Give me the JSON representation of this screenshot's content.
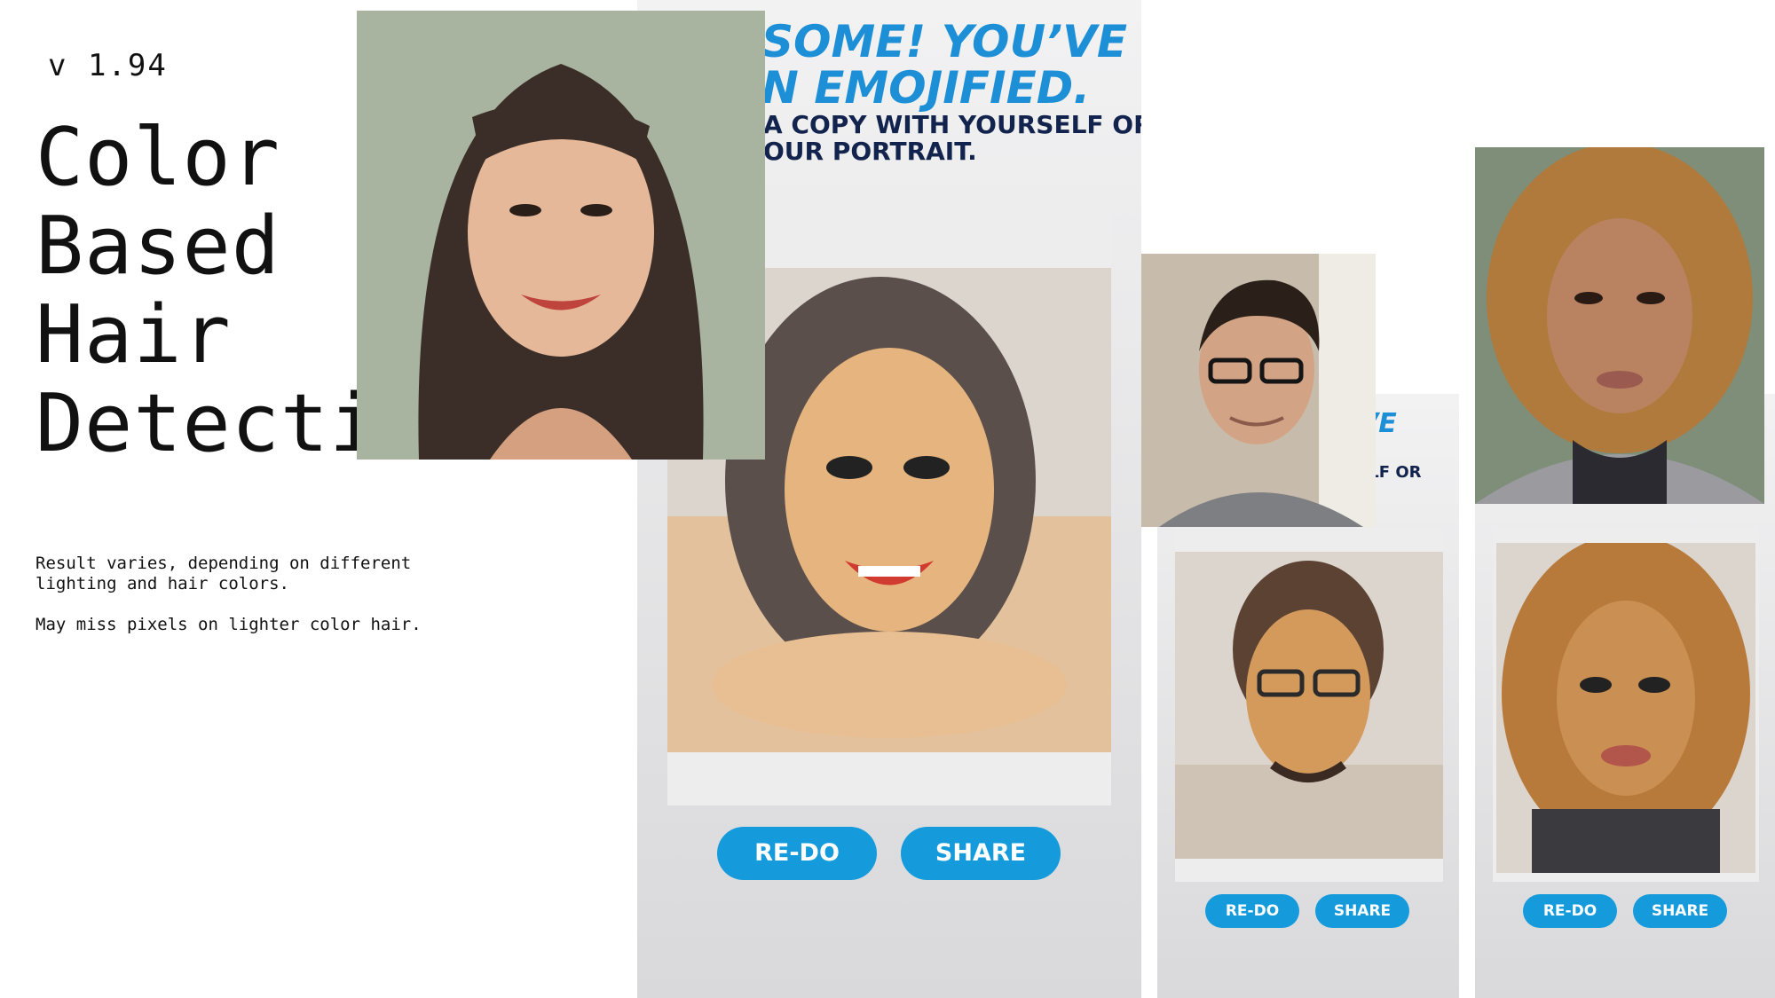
{
  "version": "v 1.94",
  "title_lines": [
    "Color",
    "Based",
    "Hair",
    "Detection"
  ],
  "notes": [
    "Result varies, depending on different lighting and hair colors.",
    "May miss pixels on lighter color hair."
  ],
  "screens": [
    {
      "headline_1": "SOME! YOU’VE",
      "headline_2": "N EMOJIFIED.",
      "subline_1": "A COPY WITH YOURSELF OR",
      "subline_2": "OUR PORTRAIT.",
      "redo_label": "RE-DO",
      "share_label": "SHARE"
    },
    {
      "headline_1": "VE",
      "subline_1": "ELF OR",
      "redo_label": "RE-DO",
      "share_label": "SHARE"
    },
    {
      "redo_label": "RE-DO",
      "share_label": "SHARE"
    }
  ],
  "colors": {
    "accent_blue": "#159bdc",
    "headline_blue": "#1d8fd6",
    "navy": "#12234d"
  }
}
